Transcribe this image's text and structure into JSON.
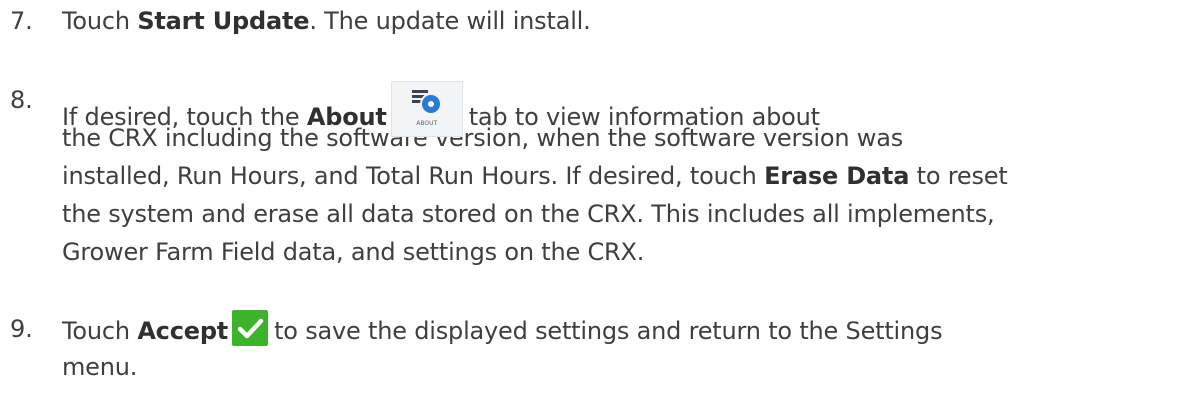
{
  "steps": [
    {
      "number": "7.",
      "lead": "Touch ",
      "bold": "Start Update",
      "rest": ". The update will install."
    },
    {
      "number": "8.",
      "line1_lead": "If desired, touch the ",
      "line1_bold": "About",
      "line1_rest": "tab to view information about",
      "icon_caption": "ABOUT",
      "line2": "the CRX including the software version, when the software version was",
      "line3_lead": "installed, Run Hours, and Total Run Hours. If desired, touch ",
      "line3_bold": "Erase Data",
      "line3_rest": " to reset",
      "line4": "the system and erase all data stored on the CRX. This includes all implements,",
      "line5": "Grower Farm Field data, and settings on the CRX."
    },
    {
      "number": "9.",
      "line1_lead": "Touch ",
      "line1_bold": "Accept",
      "line1_rest": "to save the displayed settings and return to the Settings",
      "line2": "menu."
    }
  ],
  "icons": {
    "about_tab": "about-info-icon",
    "accept": "checkmark-icon"
  },
  "colors": {
    "text": "#3f3f3f",
    "about_icon_accent": "#2a7bd6",
    "accept_icon_green": "#3cb32a"
  }
}
